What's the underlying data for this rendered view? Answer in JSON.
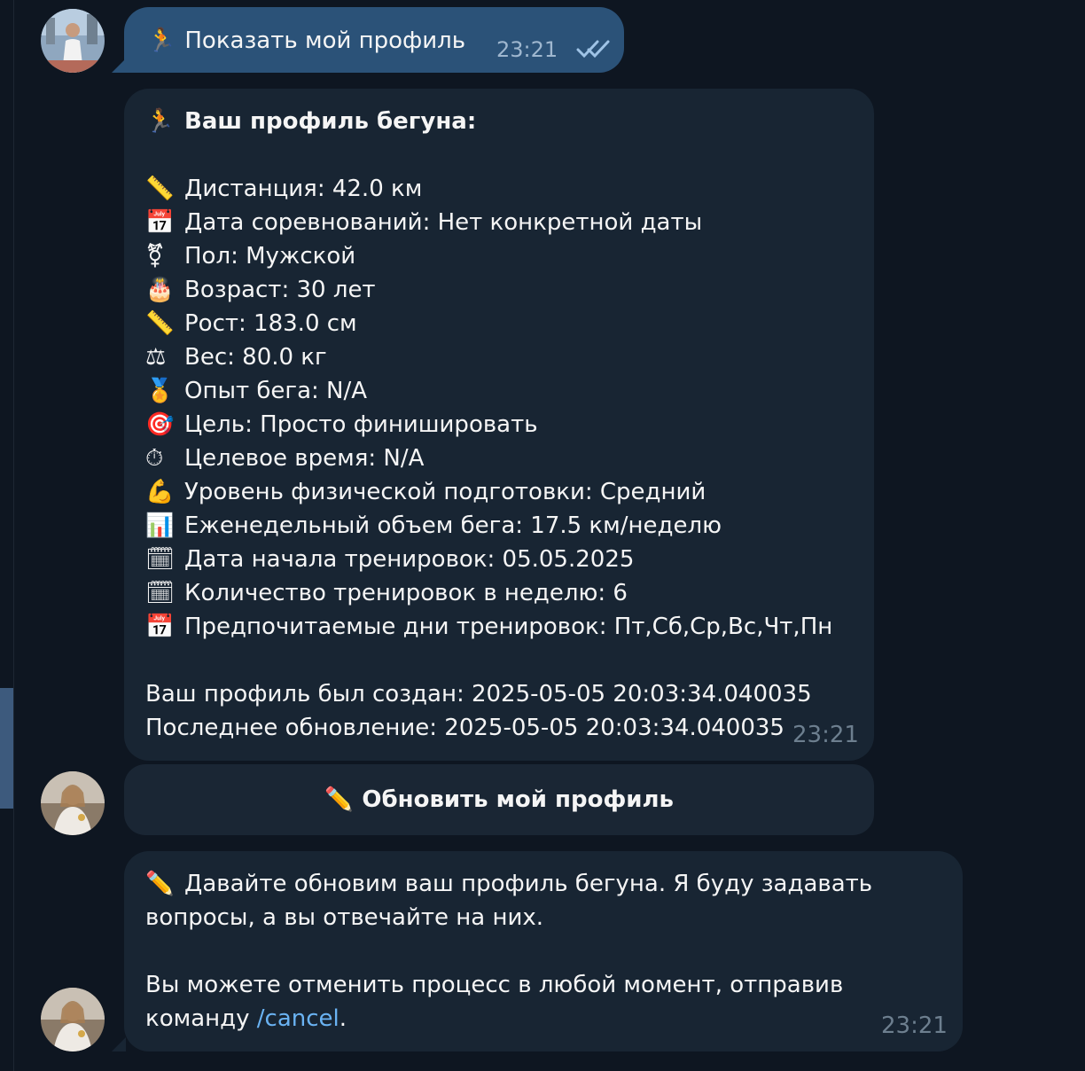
{
  "chat": {
    "outgoing": {
      "icon": "runner-icon",
      "text": "Показать мой профиль",
      "time": "23:21",
      "status": "double-check-read"
    },
    "profile_message": {
      "title_icon": "runner-icon",
      "title": "Ваш профиль бегуна:",
      "fields": [
        {
          "icon": "ruler-icon",
          "emoji": "📏",
          "text": "Дистанция: 42.0 км"
        },
        {
          "icon": "calendar-icon",
          "emoji": "📅",
          "text": "Дата соревнований: Нет конкретной даты"
        },
        {
          "icon": "gender-icon",
          "emoji": "⚧",
          "text": "Пол: Мужской"
        },
        {
          "icon": "cake-icon",
          "emoji": "🎂",
          "text": "Возраст: 30 лет"
        },
        {
          "icon": "ruler-icon",
          "emoji": "📏",
          "text": "Рост: 183.0 см"
        },
        {
          "icon": "scales-icon",
          "emoji": "⚖",
          "text": "Вес: 80.0 кг"
        },
        {
          "icon": "medal-icon",
          "emoji": "🏅",
          "text": "Опыт бега: N/A"
        },
        {
          "icon": "target-icon",
          "emoji": "🎯",
          "text": "Цель: Просто финишировать"
        },
        {
          "icon": "stopwatch-icon",
          "emoji": "⏱",
          "text": "Целевое время: N/A"
        },
        {
          "icon": "muscle-icon",
          "emoji": "💪",
          "text": "Уровень физической подготовки: Средний"
        },
        {
          "icon": "bar-chart-icon",
          "emoji": "📊",
          "text": "Еженедельный объем бега: 17.5 км/неделю"
        },
        {
          "icon": "spiral-calendar-icon",
          "emoji": "🗓",
          "text": "Дата начала тренировок: 05.05.2025"
        },
        {
          "icon": "spiral-calendar-icon",
          "emoji": "🗓",
          "text": "Количество тренировок в неделю: 6"
        },
        {
          "icon": "calendar-icon",
          "emoji": "📅",
          "text": "Предпочитаемые дни тренировок: Пт,Сб,Ср,Вс,Чт,Пн"
        }
      ],
      "created": "Ваш профиль был создан: 2025-05-05 20:03:34.040035",
      "updated": "Последнее обновление: 2025-05-05 20:03:34.040035",
      "time": "23:21"
    },
    "keyboard_button": {
      "icon": "pencil-icon",
      "label": "Обновить мой профиль"
    },
    "update_message": {
      "line1": "Давайте обновим ваш профиль бегуна. Я буду задавать",
      "line2": "вопросы, а вы отвечайте на них.",
      "line3": "Вы можете отменить процесс в любой момент, отправив",
      "line4_prefix": "команду ",
      "command": "/cancel",
      "line4_suffix": ".",
      "time": "23:21"
    }
  },
  "colors": {
    "background": "#0e1621",
    "outgoing_bubble": "#2b5278",
    "incoming_bubble": "#182533",
    "link": "#6ab3f3",
    "time_incoming": "#6d7f8f"
  }
}
